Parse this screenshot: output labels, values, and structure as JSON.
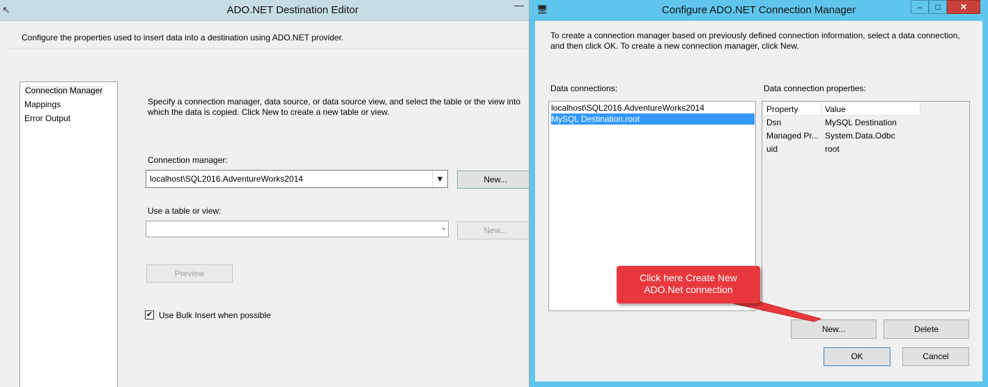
{
  "left_window": {
    "title": "ADO.NET Destination Editor",
    "minimize_glyph": "—",
    "description": "Configure the properties used to insert data into a destination using ADO.NET provider.",
    "nav": [
      "Connection Manager",
      "Mappings",
      "Error Output"
    ],
    "instructions": "Specify a connection manager, data source, or data source view, and select the table or the view into which the data is copied. Click New to create a new table or view.",
    "connection_manager_label": "Connection manager:",
    "connection_manager_value": "localhost\\SQL2016.AdventureWorks2014",
    "new_button": "New...",
    "table_label": "Use a table or view:",
    "table_value": "",
    "table_new_button": "New...",
    "preview_button": "Preview",
    "bulk_insert_label": "Use Bulk Insert when possible",
    "bulk_insert_checked": true
  },
  "right_window": {
    "title": "Configure ADO.NET Connection Manager",
    "description": "To create a connection manager based on previously defined connection information, select a data connection, and then click OK. To create a new connection manager, click New.",
    "data_connections_label": "Data connections:",
    "data_connections": [
      "localhost\\SQL2016.AdventureWorks2014",
      "MySQL Destination.root"
    ],
    "selected_index": 1,
    "properties_label": "Data connection properties:",
    "properties_headers": [
      "Property",
      "Value"
    ],
    "properties": [
      {
        "property": "Dsn",
        "value": "MySQL Destination"
      },
      {
        "property": "Managed Pr...",
        "value": "System.Data.Odbc"
      },
      {
        "property": "uid",
        "value": "root"
      }
    ],
    "new_button": "New...",
    "delete_button": "Delete",
    "ok_button": "OK",
    "cancel_button": "Cancel"
  },
  "callout": {
    "line1": "Click here Create New",
    "line2": "ADO.Net connection",
    "color": "#e8383d"
  },
  "colors": {
    "active_title_bar": "#5fc5ec",
    "inactive_title_bar": "#c7dde4",
    "selection": "#3399ff",
    "close_button": "#c7413a"
  }
}
